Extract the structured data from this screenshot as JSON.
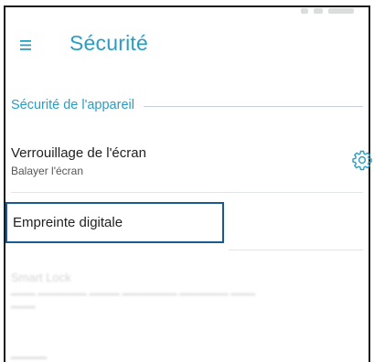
{
  "app_bar": {
    "title": "Sécurité",
    "menu_icon": "hamburger-menu-icon",
    "accent_color": "#2a9ec2"
  },
  "section": {
    "header": "Sécurité de l'appareil"
  },
  "items": [
    {
      "title": "Verrouillage de l'écran",
      "summary": "Balayer l'écran",
      "trailing_icon": "gear-icon"
    },
    {
      "title": "Empreinte digitale",
      "highlighted": true,
      "highlight_color": "#1a5b8f"
    },
    {
      "title": "Smart Lock",
      "summary": "",
      "disabled": true
    }
  ]
}
